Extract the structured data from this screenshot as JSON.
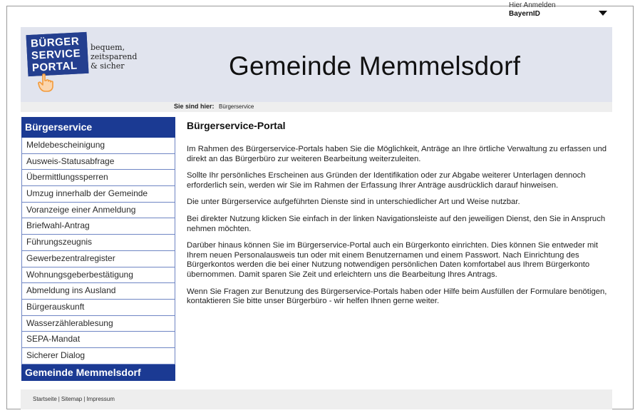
{
  "login": {
    "label": "Hier Anmelden",
    "value": "BayernID",
    "icon": "triangle-down"
  },
  "logo": {
    "lines": [
      "BÜRGER",
      "SERVICE",
      "PORTAL"
    ],
    "tagline": [
      "bequem,",
      "zeitsparend",
      "& sicher"
    ],
    "icon": "pointing-hand"
  },
  "header": {
    "title": "Gemeinde Memmelsdorf"
  },
  "breadcrumb": {
    "label": "Sie sind hier:",
    "current": "Bürgerservice"
  },
  "sidebar": {
    "header": "Bürgerservice",
    "items": [
      "Meldebescheinigung",
      "Ausweis-Statusabfrage",
      "Übermittlungssperren",
      "Umzug innerhalb der Gemeinde",
      "Voranzeige einer Anmeldung",
      "Briefwahl-Antrag",
      "Führungszeugnis",
      "Gewerbezentralregister",
      "Wohnungsgeberbestätigung",
      "Abmeldung ins Ausland",
      "Bürgerauskunft",
      "Wasserzählerablesung",
      "SEPA-Mandat",
      "Sicherer Dialog"
    ],
    "footer": "Gemeinde Memmelsdorf"
  },
  "content": {
    "title": "Bürgerservice-Portal",
    "paragraphs": [
      "Im Rahmen des Bürgerservice-Portals haben Sie die Möglichkeit, Anträge an Ihre örtliche Verwaltung zu erfassen und direkt an das Bürgerbüro zur weiteren Bearbeitung weiterzuleiten.",
      "Sollte Ihr persönliches Erscheinen aus Gründen der Identifikation oder zur Abgabe weiterer Unterlagen dennoch erforderlich sein, werden wir Sie im Rahmen der Erfassung Ihrer Anträge ausdrücklich darauf hinweisen.",
      "Die unter Bürgerservice aufgeführten Dienste sind in unterschiedlicher Art und Weise nutzbar.",
      "Bei direkter Nutzung klicken Sie einfach in der linken Navigationsleiste auf den jeweiligen Dienst, den Sie in Anspruch nehmen möchten.",
      "Darüber hinaus können Sie im Bürgerservice-Portal auch ein Bürgerkonto einrichten. Dies können Sie entweder mit Ihrem neuen Personalausweis tun oder mit einem Benutzernamen und einem Passwort. Nach Einrichtung des Bürgerkontos werden die bei einer Nutzung notwendigen persönlichen Daten komfortabel aus Ihrem Bürgerkonto übernommen. Damit sparen Sie Zeit und erleichtern uns die Bearbeitung Ihres Antrags.",
      "Wenn Sie Fragen zur Benutzung des Bürgerservice-Portals haben oder Hilfe beim Ausfüllen der Formulare benötigen, kontaktieren Sie bitte unser Bürgerbüro - wir helfen Ihnen gerne weiter."
    ]
  },
  "footer": {
    "links": [
      "Startseite",
      "Sitemap",
      "Impressum"
    ],
    "separator": "|"
  },
  "colors": {
    "brand_blue": "#1b3a93",
    "header_bg": "#e1e4ee",
    "hand_orange": "#f39a3a"
  }
}
